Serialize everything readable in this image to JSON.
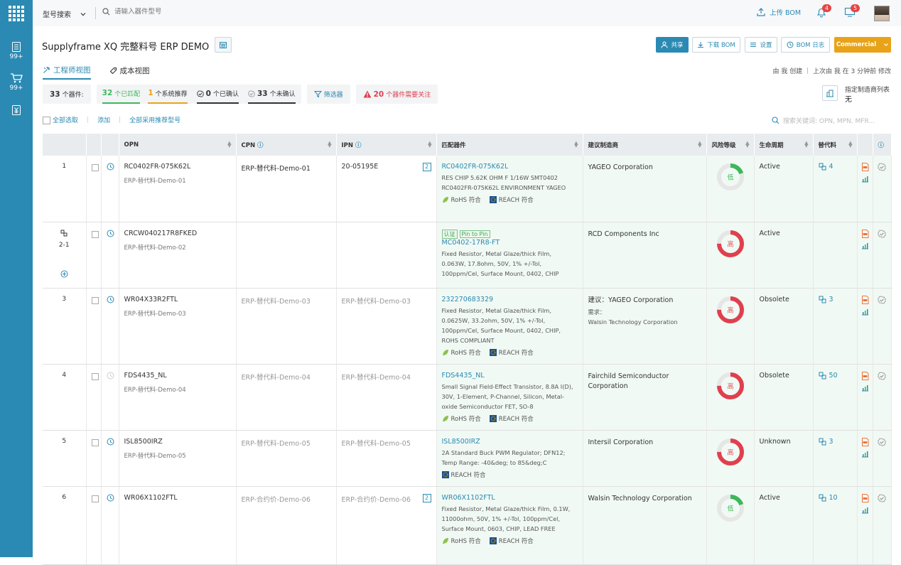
{
  "topbar": {
    "search_mode": "型号搜索",
    "search_placeholder": "请输入器件型号",
    "upload_label": "上传 BOM",
    "notif_count": "4",
    "msg_count": "5"
  },
  "sidebar": {
    "items": [
      {
        "icon": "document-list-icon",
        "badge": "99+"
      },
      {
        "icon": "cart-icon",
        "badge": "99+"
      },
      {
        "icon": "price-icon",
        "badge": ""
      }
    ]
  },
  "header": {
    "title": "Supplyframe XQ 完整料号 ERP DEMO",
    "share": "共享",
    "download": "下载 BOM",
    "settings": "设置",
    "bom_log": "BOM 日志",
    "plan": "Commercial"
  },
  "tabs": [
    {
      "label": "工程师视图"
    },
    {
      "label": "成本视图"
    }
  ],
  "created_info": "由 我 创建 ｜ 上次由 我 在 3 分钟前 修改",
  "stats": {
    "total_n": "33",
    "total_label": "个器件:",
    "matched_n": "32",
    "matched_label": "个已匹配",
    "recommended_n": "1",
    "recommended_label": "个系统推荐",
    "confirmed_n": "0",
    "confirmed_label": "个已确认",
    "unconfirmed_n": "33",
    "unconfirmed_label": "个未确认",
    "filter_label": "筛选器",
    "attention_n": "20",
    "attention_label": "个器件需要关注"
  },
  "mfr_list": {
    "label": "指定制造商列表",
    "value": "无"
  },
  "toolrow": {
    "select_all": "全部选取",
    "add": "添加",
    "use_recommended": "全部采用推荐型号"
  },
  "search_keywords_placeholder": "搜索关键词: OPN, MPN, MFR...",
  "columns": {
    "opn": "OPN",
    "cpn": "CPN",
    "ipn": "IPN",
    "match": "匹配器件",
    "mfr": "建议制造商",
    "risk": "风险等级",
    "lifecycle": "生命周期",
    "alt": "替代料"
  },
  "colors": {
    "accent": "#2b8ab3",
    "risk_low": "#3cb85a",
    "risk_high": "#e0404e"
  },
  "rows": [
    {
      "no": "1",
      "opn": "RC0402FR-075K62L",
      "opn_sub": "ERP-替代料-Demo-01",
      "cpn": "ERP-替代料-Demo-01",
      "ipn": "20-05195E",
      "ipn_box": "2",
      "match_tags": "",
      "match_tag2": "",
      "match_pn": "RC0402FR-075K62L",
      "match_desc": "RES CHIP 5.62K OHM F 1/16W SMT0402 RC0402FR-075K62L ENVIRONMENT YAGEO",
      "rohs": "RoHS 符合",
      "reach": "REACH 符合",
      "mfr": "YAGEO Corporation",
      "mfr_req_label": "",
      "mfr_req": "",
      "risk": "低",
      "risk_level": "low",
      "risk_fraction": 0.2,
      "lifecycle": "Active",
      "alt": "4"
    },
    {
      "no": "2-1",
      "opn": "CRCW040217R8FKED",
      "opn_sub": "ERP-替代料-Demo-02",
      "cpn": "",
      "ipn": "",
      "ipn_box": "",
      "match_tags": "认证",
      "match_tag2": "Pin to Pin",
      "match_pn": "MC0402-17R8-FT",
      "match_desc": "Fixed Resistor, Metal Glaze/thick Film, 0.063W, 17.8ohm, 50V, 1% +/-Tol, 100ppm/Cel, Surface Mount, 0402, CHIP",
      "rohs": "",
      "reach": "",
      "mfr": "RCD Components Inc",
      "mfr_req_label": "",
      "mfr_req": "",
      "risk": "高",
      "risk_level": "high",
      "risk_fraction": 0.75,
      "lifecycle": "Active",
      "alt": ""
    },
    {
      "no": "3",
      "opn": "WR04X33R2FTL",
      "opn_sub": "ERP-替代料-Demo-03",
      "cpn": "ERP-替代料-Demo-03",
      "ipn": "ERP-替代料-Demo-03",
      "ipn_box": "",
      "match_tags": "",
      "match_tag2": "",
      "match_pn": "232270683329",
      "match_desc": "Fixed Resistor, Metal Glaze/thick Film, 0.0625W, 33.2ohm, 50V, 1% +/-Tol, 100ppm/Cel, Surface Mount, 0402, CHIP, ROHS COMPLIANT",
      "rohs": "RoHS 符合",
      "reach": "REACH 符合",
      "mfr": "建议：YAGEO Corporation",
      "mfr_req_label": "需求：",
      "mfr_req": "Walsin Technology Corporation",
      "risk": "高",
      "risk_level": "high",
      "risk_fraction": 0.75,
      "lifecycle": "Obsolete",
      "alt": "3"
    },
    {
      "no": "4",
      "opn": "FDS4435_NL",
      "opn_sub": "ERP-替代料-Demo-04",
      "cpn": "ERP-替代料-Demo-04",
      "ipn": "ERP-替代料-Demo-04",
      "ipn_box": "",
      "match_tags": "",
      "match_tag2": "",
      "match_pn": "FDS4435_NL",
      "match_desc": "Small Signal Field-Effect Transistor, 8.8A I(D), 30V, 1-Element, P-Channel, Silicon, Metal-oxide Semiconductor FET, SO-8",
      "rohs": "RoHS 符合",
      "reach": "REACH 符合",
      "mfr": "Fairchild Semiconductor Corporation",
      "mfr_req_label": "",
      "mfr_req": "",
      "risk": "高",
      "risk_level": "high",
      "risk_fraction": 0.75,
      "lifecycle": "Obsolete",
      "alt": "50"
    },
    {
      "no": "5",
      "opn": "ISL8500IRZ",
      "opn_sub": "ERP-替代料-Demo-05",
      "cpn": "ERP-替代料-Demo-05",
      "ipn": "ERP-替代料-Demo-05",
      "ipn_box": "",
      "match_tags": "",
      "match_tag2": "",
      "match_pn": "ISL8500IRZ",
      "match_desc": "2A Standard Buck PWM Regulator; DFN12; Temp Range: -40&deg; to 85&deg;C",
      "rohs": "",
      "reach": "REACH 符合",
      "mfr": "Intersil Corporation",
      "mfr_req_label": "",
      "mfr_req": "",
      "risk": "高",
      "risk_level": "high",
      "risk_fraction": 0.75,
      "lifecycle": "Unknown",
      "alt": "3"
    },
    {
      "no": "6",
      "opn": "WR06X1102FTL",
      "opn_sub": "",
      "cpn": "ERP-合约价-Demo-06",
      "ipn": "ERP-合约价-Demo-06",
      "ipn_box": "2",
      "match_tags": "",
      "match_tag2": "",
      "match_pn": "WR06X1102FTL",
      "match_desc": "Fixed Resistor, Metal Glaze/thick Film, 0.1W, 11000ohm, 50V, 1% +/-Tol, 100ppm/Cel, Surface Mount, 0603, CHIP, LEAD FREE",
      "rohs": "RoHS 符合",
      "reach": "REACH 符合",
      "mfr": "Walsin Technology Corporation",
      "mfr_req_label": "",
      "mfr_req": "",
      "risk": "低",
      "risk_level": "low",
      "risk_fraction": 0.2,
      "lifecycle": "Active",
      "alt": "10"
    }
  ]
}
